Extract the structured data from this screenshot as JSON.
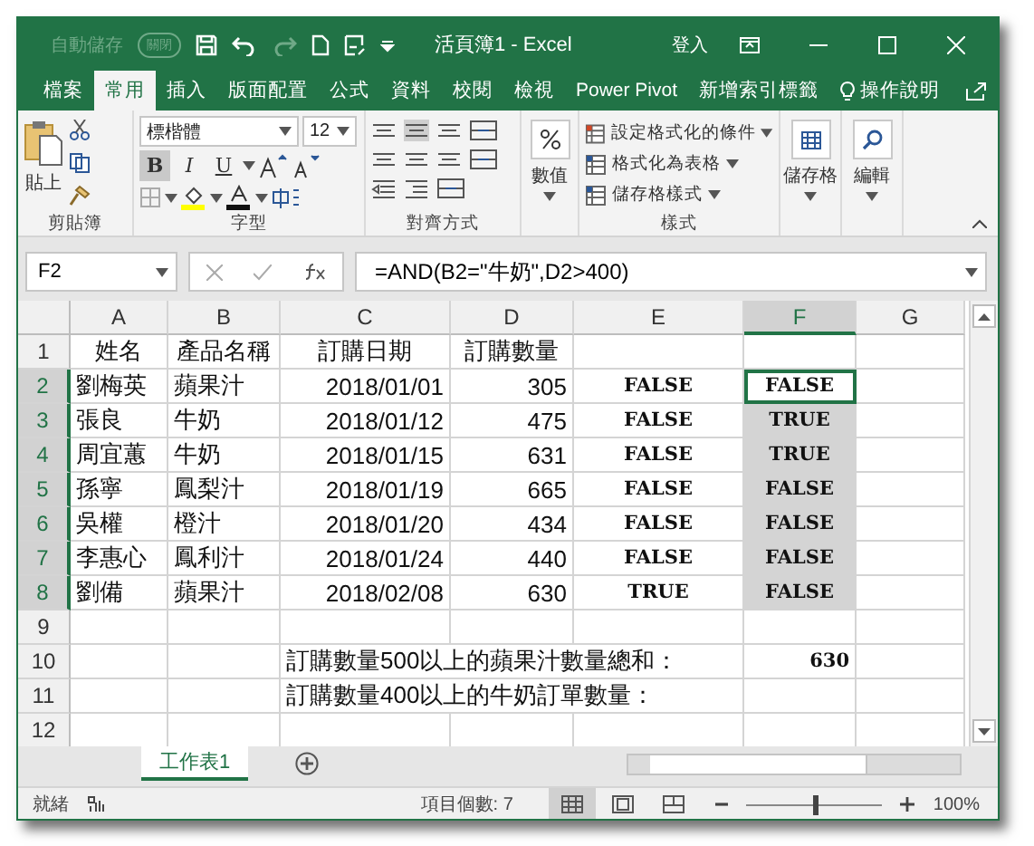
{
  "title_bar": {
    "autosave_label": "自動儲存",
    "autosave_toggle": "關閉",
    "title": "活頁簿1  -  Excel",
    "signin": "登入"
  },
  "menu_tabs": [
    {
      "label": "檔案",
      "selected": false
    },
    {
      "label": "常用",
      "selected": true
    },
    {
      "label": "插入",
      "selected": false
    },
    {
      "label": "版面配置",
      "selected": false
    },
    {
      "label": "公式",
      "selected": false
    },
    {
      "label": "資料",
      "selected": false
    },
    {
      "label": "校閱",
      "selected": false
    },
    {
      "label": "檢視",
      "selected": false
    },
    {
      "label": "Power Pivot",
      "selected": false
    },
    {
      "label": "新增索引標籤",
      "selected": false
    }
  ],
  "tell_me": "操作說明",
  "ribbon": {
    "clipboard": {
      "paste": "貼上",
      "label": "剪貼簿"
    },
    "font": {
      "font_name": "標楷體",
      "font_size": "12",
      "bold": "B",
      "italic": "I",
      "underline": "U",
      "bold_on": true,
      "label": "字型"
    },
    "alignment": {
      "label": "對齊方式"
    },
    "number": {
      "button": "數值"
    },
    "styles": {
      "items": [
        "設定格式化的條件",
        "格式化為表格",
        "儲存格樣式"
      ],
      "label": "樣式"
    },
    "cells": {
      "button": "儲存格"
    },
    "editing": {
      "button": "編輯"
    }
  },
  "formula_bar": {
    "name_box": "F2",
    "formula": "=AND(B2=\"牛奶\",D2>400)"
  },
  "sheet": {
    "columns": [
      {
        "label": "A",
        "selected": false
      },
      {
        "label": "B",
        "selected": false
      },
      {
        "label": "C",
        "selected": false
      },
      {
        "label": "D",
        "selected": false
      },
      {
        "label": "E",
        "selected": false
      },
      {
        "label": "F",
        "selected": true
      },
      {
        "label": "G",
        "selected": false
      }
    ],
    "rows": [
      {
        "label": "1",
        "kind": "header",
        "selected": false,
        "cells": {
          "A": "姓名",
          "B": "產品名稱",
          "C": "訂購日期",
          "D": "訂購數量"
        }
      },
      {
        "label": "2",
        "kind": "data",
        "selected": true,
        "cells": {
          "A": "劉梅英",
          "B": "蘋果汁",
          "C": "2018/01/01",
          "D": "305",
          "E": "FALSE",
          "F": "FALSE"
        }
      },
      {
        "label": "3",
        "kind": "data",
        "selected": true,
        "cells": {
          "A": "張良",
          "B": "牛奶",
          "C": "2018/01/12",
          "D": "475",
          "E": "FALSE",
          "F": "TRUE"
        }
      },
      {
        "label": "4",
        "kind": "data",
        "selected": true,
        "cells": {
          "A": "周宜蕙",
          "B": "牛奶",
          "C": "2018/01/15",
          "D": "631",
          "E": "FALSE",
          "F": "TRUE"
        }
      },
      {
        "label": "5",
        "kind": "data",
        "selected": true,
        "cells": {
          "A": "孫寧",
          "B": "鳳梨汁",
          "C": "2018/01/19",
          "D": "665",
          "E": "FALSE",
          "F": "FALSE"
        }
      },
      {
        "label": "6",
        "kind": "data",
        "selected": true,
        "cells": {
          "A": "吳權",
          "B": "橙汁",
          "C": "2018/01/20",
          "D": "434",
          "E": "FALSE",
          "F": "FALSE"
        }
      },
      {
        "label": "7",
        "kind": "data",
        "selected": true,
        "cells": {
          "A": "李惠心",
          "B": "鳳利汁",
          "C": "2018/01/24",
          "D": "440",
          "E": "FALSE",
          "F": "FALSE"
        }
      },
      {
        "label": "8",
        "kind": "data",
        "selected": true,
        "cells": {
          "A": "劉備",
          "B": "蘋果汁",
          "C": "2018/02/08",
          "D": "630",
          "E": "TRUE",
          "F": "FALSE"
        }
      },
      {
        "label": "9",
        "kind": "data",
        "selected": false,
        "cells": {}
      },
      {
        "label": "10",
        "kind": "summary",
        "selected": false,
        "cells": {
          "C": "訂購數量500以上的蘋果汁數量總和：",
          "F": "630"
        }
      },
      {
        "label": "11",
        "kind": "summary",
        "selected": false,
        "cells": {
          "C": "訂購數量400以上的牛奶訂單數量："
        }
      },
      {
        "label": "12",
        "kind": "data",
        "selected": false,
        "cells": {}
      }
    ]
  },
  "sheet_tabs": [
    {
      "label": "工作表1",
      "selected": true
    }
  ],
  "status_bar": {
    "ready": "就緒",
    "count": "項目個數: 7",
    "zoom_slider": {
      "level": 0.5
    },
    "zoom": "100%"
  }
}
